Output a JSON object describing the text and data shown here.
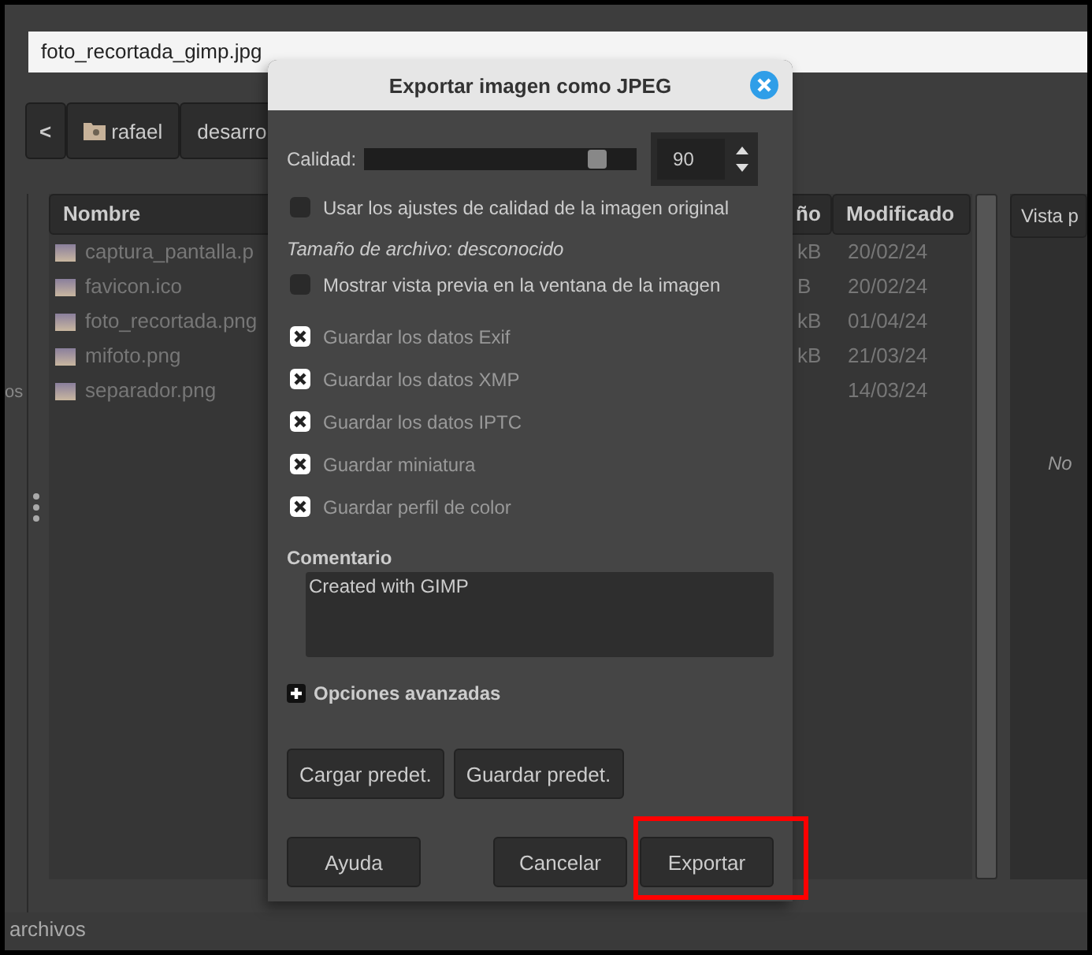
{
  "filename_field": {
    "value": "foto_recortada_gimp.jpg"
  },
  "path_bar": {
    "back": "<",
    "items": [
      {
        "label": "rafael",
        "kind": "folder"
      },
      {
        "label": "desarro",
        "kind": "plain"
      }
    ]
  },
  "sidebar": {
    "texts": [
      "os"
    ]
  },
  "file_list": {
    "columns": [
      "Nombre",
      "ño",
      "Modificado"
    ],
    "rows": [
      {
        "name": "captura_pantalla.p",
        "size": "kB",
        "modified": "20/02/24"
      },
      {
        "name": "favicon.ico",
        "size": "B",
        "modified": "20/02/24"
      },
      {
        "name": "foto_recortada.png",
        "size": "kB",
        "modified": "01/04/24"
      },
      {
        "name": "mifoto.png",
        "size": "kB",
        "modified": "21/03/24"
      },
      {
        "name": "separador.png",
        "size": "",
        "modified": "14/03/24"
      }
    ]
  },
  "preview": {
    "header": "Vista p",
    "message": "No"
  },
  "status_bar": "archivos",
  "dialog": {
    "title": "Exportar imagen como JPEG",
    "quality_label": "Calidad:",
    "quality": {
      "level": 0.9,
      "value": "90"
    },
    "options": [
      {
        "label": "Usar los ajustes de calidad de la imagen original",
        "checked": false,
        "disabled": false,
        "kind": "check"
      },
      {
        "label": "Tamaño de archivo: desconocido",
        "kind": "note"
      },
      {
        "label": "Mostrar vista previa en la ventana de la imagen",
        "checked": false,
        "disabled": false,
        "kind": "check"
      },
      {
        "label": "Guardar los datos Exif",
        "checked": true,
        "disabled": true,
        "kind": "check"
      },
      {
        "label": "Guardar los datos XMP",
        "checked": true,
        "disabled": true,
        "kind": "check"
      },
      {
        "label": "Guardar los datos IPTC",
        "checked": true,
        "disabled": true,
        "kind": "check"
      },
      {
        "label": "Guardar miniatura",
        "checked": true,
        "disabled": true,
        "kind": "check"
      },
      {
        "label": "Guardar perfil de color",
        "checked": true,
        "disabled": true,
        "kind": "check"
      }
    ],
    "comment_label": "Comentario",
    "comment": "Created with GIMP",
    "advanced": {
      "label": "Opciones avanzadas",
      "expanded": false
    },
    "preset_buttons": [
      "Cargar predet.",
      "Guardar predet."
    ],
    "help_button": "Ayuda",
    "cancel_button": "Cancelar",
    "export_button": {
      "label": "Exportar",
      "highlighted": true
    }
  }
}
